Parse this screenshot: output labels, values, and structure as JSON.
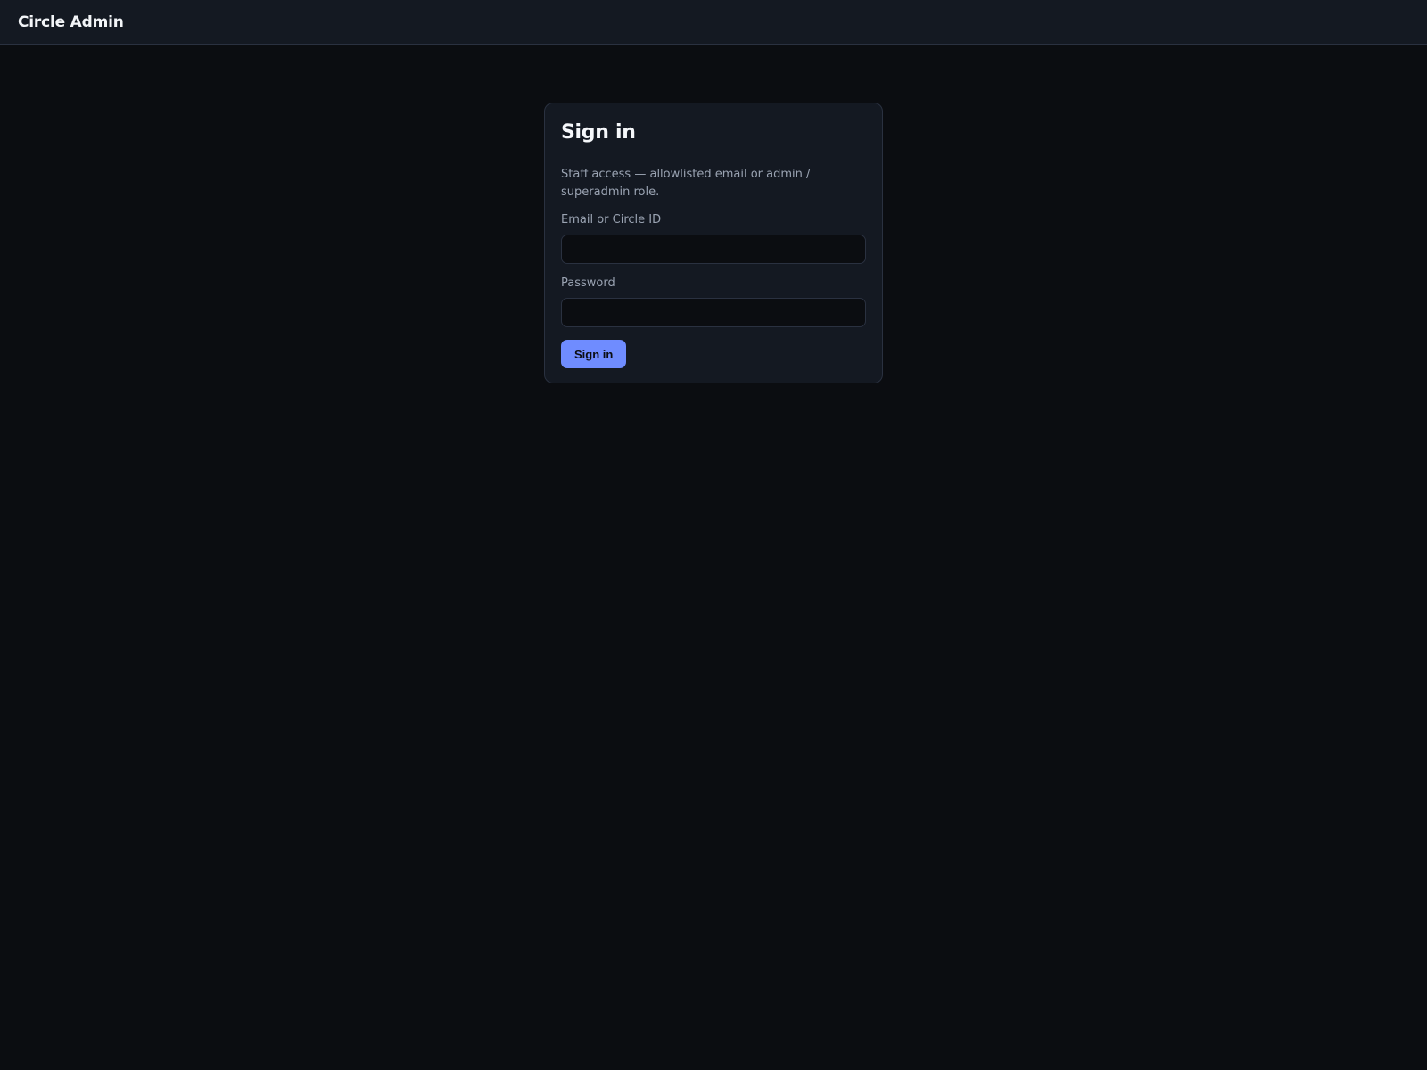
{
  "header": {
    "brand": "Circle Admin"
  },
  "login": {
    "title": "Sign in",
    "subtitle": "Staff access — allowlisted email or admin / superadmin role.",
    "email_label": "Email or Circle ID",
    "email_value": "",
    "password_label": "Password",
    "password_value": "",
    "submit_label": "Sign in"
  },
  "colors": {
    "background": "#0b0d11",
    "panel": "#141922",
    "border": "#2a3140",
    "accent": "#6f8cff",
    "muted_text": "#9aa3b2"
  }
}
